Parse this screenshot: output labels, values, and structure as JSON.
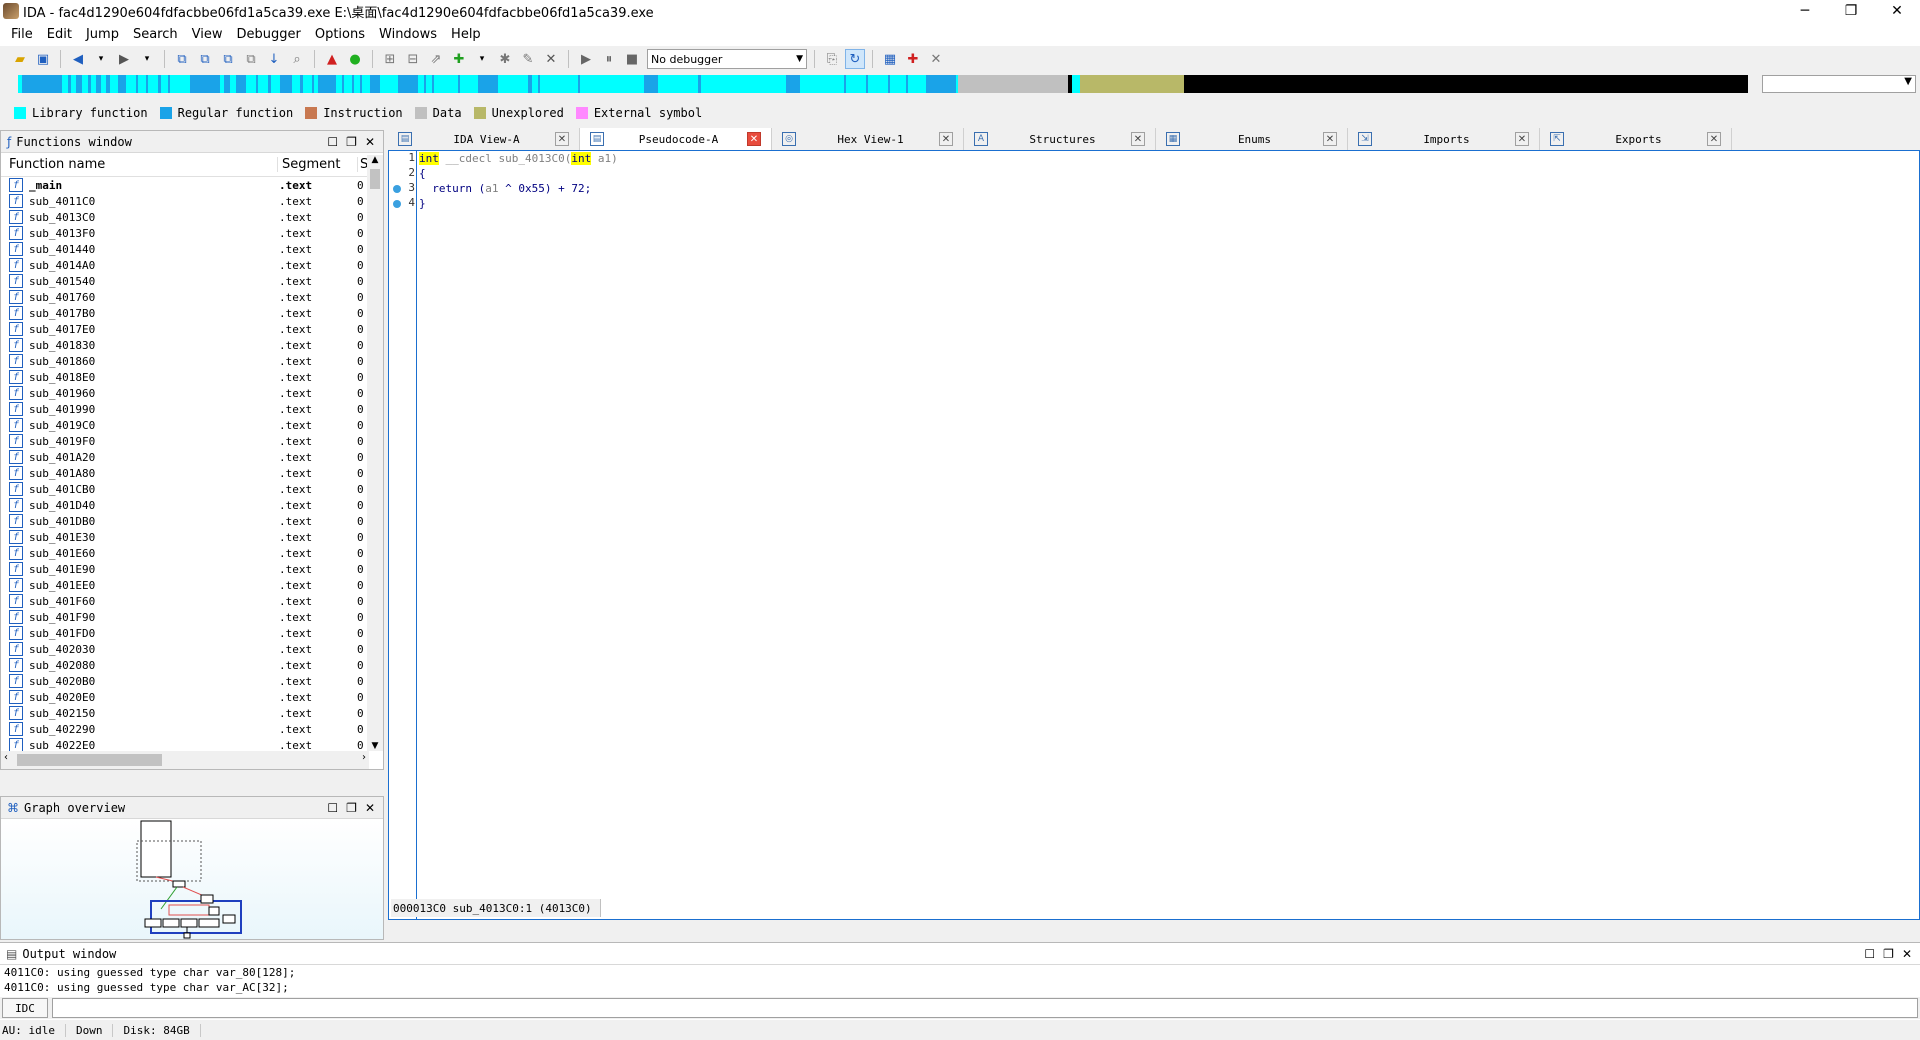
{
  "window": {
    "title": "IDA - fac4d1290e604fdfacbbe06fd1a5ca39.exe E:\\桌面\\fac4d1290e604fdfacbbe06fd1a5ca39.exe",
    "minimize": "─",
    "restore": "❐",
    "close": "✕"
  },
  "menu": [
    "File",
    "Edit",
    "Jump",
    "Search",
    "View",
    "Debugger",
    "Options",
    "Windows",
    "Help"
  ],
  "toolbar": {
    "debugger_select": "No debugger"
  },
  "legend": [
    {
      "label": "Library function",
      "color": "#00ffff"
    },
    {
      "label": "Regular function",
      "color": "#1aa3e8"
    },
    {
      "label": "Instruction",
      "color": "#c87850"
    },
    {
      "label": "Data",
      "color": "#c0c0c0"
    },
    {
      "label": "Unexplored",
      "color": "#b8b868"
    },
    {
      "label": "External symbol",
      "color": "#ff88ff"
    }
  ],
  "functions_window": {
    "title": "Functions window",
    "col_name": "Function name",
    "col_segment": "Segment",
    "col_extra": "S",
    "rows": [
      {
        "name": "_main",
        "segment": ".text",
        "extra": "0"
      },
      {
        "name": "sub_4011C0",
        "segment": ".text",
        "extra": "0"
      },
      {
        "name": "sub_4013C0",
        "segment": ".text",
        "extra": "0"
      },
      {
        "name": "sub_4013F0",
        "segment": ".text",
        "extra": "0"
      },
      {
        "name": "sub_401440",
        "segment": ".text",
        "extra": "0"
      },
      {
        "name": "sub_4014A0",
        "segment": ".text",
        "extra": "0"
      },
      {
        "name": "sub_401540",
        "segment": ".text",
        "extra": "0"
      },
      {
        "name": "sub_401760",
        "segment": ".text",
        "extra": "0"
      },
      {
        "name": "sub_4017B0",
        "segment": ".text",
        "extra": "0"
      },
      {
        "name": "sub_4017E0",
        "segment": ".text",
        "extra": "0"
      },
      {
        "name": "sub_401830",
        "segment": ".text",
        "extra": "0"
      },
      {
        "name": "sub_401860",
        "segment": ".text",
        "extra": "0"
      },
      {
        "name": "sub_4018E0",
        "segment": ".text",
        "extra": "0"
      },
      {
        "name": "sub_401960",
        "segment": ".text",
        "extra": "0"
      },
      {
        "name": "sub_401990",
        "segment": ".text",
        "extra": "0"
      },
      {
        "name": "sub_4019C0",
        "segment": ".text",
        "extra": "0"
      },
      {
        "name": "sub_4019F0",
        "segment": ".text",
        "extra": "0"
      },
      {
        "name": "sub_401A20",
        "segment": ".text",
        "extra": "0"
      },
      {
        "name": "sub_401A80",
        "segment": ".text",
        "extra": "0"
      },
      {
        "name": "sub_401CB0",
        "segment": ".text",
        "extra": "0"
      },
      {
        "name": "sub_401D40",
        "segment": ".text",
        "extra": "0"
      },
      {
        "name": "sub_401DB0",
        "segment": ".text",
        "extra": "0"
      },
      {
        "name": "sub_401E30",
        "segment": ".text",
        "extra": "0"
      },
      {
        "name": "sub_401E60",
        "segment": ".text",
        "extra": "0"
      },
      {
        "name": "sub_401E90",
        "segment": ".text",
        "extra": "0"
      },
      {
        "name": "sub_401EE0",
        "segment": ".text",
        "extra": "0"
      },
      {
        "name": "sub_401F60",
        "segment": ".text",
        "extra": "0"
      },
      {
        "name": "sub_401F90",
        "segment": ".text",
        "extra": "0"
      },
      {
        "name": "sub_401FD0",
        "segment": ".text",
        "extra": "0"
      },
      {
        "name": "sub_402030",
        "segment": ".text",
        "extra": "0"
      },
      {
        "name": "sub_402080",
        "segment": ".text",
        "extra": "0"
      },
      {
        "name": "sub_4020B0",
        "segment": ".text",
        "extra": "0"
      },
      {
        "name": "sub_4020E0",
        "segment": ".text",
        "extra": "0"
      },
      {
        "name": "sub_402150",
        "segment": ".text",
        "extra": "0"
      },
      {
        "name": "sub_402290",
        "segment": ".text",
        "extra": "0"
      },
      {
        "name": "sub_4022E0",
        "segment": ".text",
        "extra": "0"
      }
    ]
  },
  "graph_overview": {
    "title": "Graph overview"
  },
  "tabs": [
    {
      "label": "IDA View-A",
      "icon": "ida-view-icon",
      "active": false
    },
    {
      "label": "Pseudocode-A",
      "icon": "pseudocode-icon",
      "active": true
    },
    {
      "label": "Hex View-1",
      "icon": "hex-view-icon",
      "active": false
    },
    {
      "label": "Structures",
      "icon": "structures-icon",
      "active": false
    },
    {
      "label": "Enums",
      "icon": "enums-icon",
      "active": false
    },
    {
      "label": "Imports",
      "icon": "imports-icon",
      "active": false
    },
    {
      "label": "Exports",
      "icon": "exports-icon",
      "active": false
    }
  ],
  "pseudocode": {
    "line_numbers": [
      "1",
      "2",
      "3",
      "4"
    ],
    "line1_kw1": "int",
    "line1_mid": " __cdecl sub_4013C0(",
    "line1_kw2": "int",
    "line1_end": " a1)",
    "line2": "{",
    "line3_a": "  return (",
    "line3_var": "a1",
    "line3_b": " ^ 0x55) + 72;",
    "line4": "}",
    "status": "000013C0 sub_4013C0:1 (4013C0)"
  },
  "output_window": {
    "title": "Output window",
    "lines": [
      "4011C0: using guessed type char var_80[128];",
      "4011C0: using guessed type char var_AC[32];"
    ],
    "idc_button": "IDC"
  },
  "statusbar": {
    "au": "AU:  idle",
    "direction": "Down",
    "disk": "Disk: 84GB"
  }
}
